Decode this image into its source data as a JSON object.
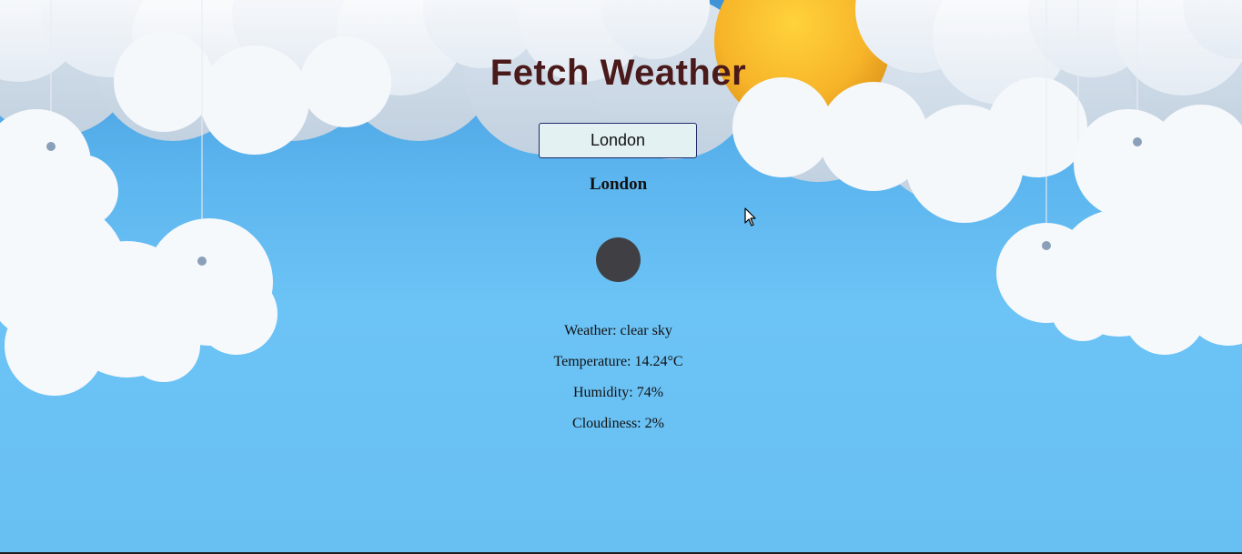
{
  "page": {
    "title": "Fetch Weather"
  },
  "search": {
    "value": "London"
  },
  "result": {
    "city": "London",
    "icon": "weather-icon",
    "weather": "Weather: clear sky",
    "temperature": "Temperature: 14.24°C",
    "humidity": "Humidity: 74%",
    "cloudiness": "Cloudiness: 2%"
  },
  "colors": {
    "title": "#4a1a1a",
    "sky": "#6cc3f5",
    "input_bg": "#e3f1f2",
    "input_border": "#1e2a6a",
    "icon": "#404044",
    "sun": "#f7b52a"
  }
}
